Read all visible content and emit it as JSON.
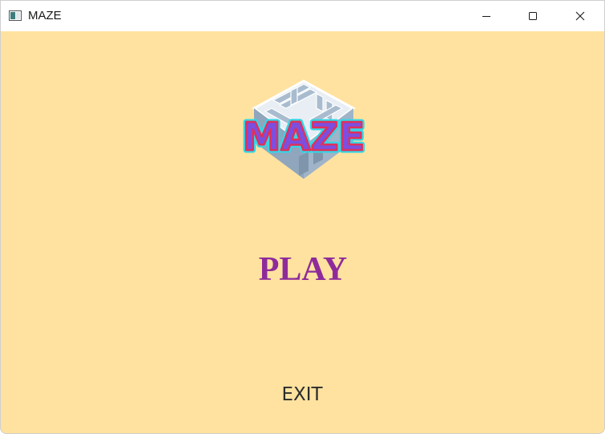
{
  "window": {
    "title": "MAZE",
    "app_icon": "window-app-icon",
    "controls": {
      "minimize_icon": "minimize-icon",
      "maximize_icon": "maximize-icon",
      "close_icon": "close-icon"
    }
  },
  "menu": {
    "logo_text": "MAZE",
    "play_label": "PLAY",
    "exit_label": "EXIT"
  },
  "colors": {
    "background": "#ffe29f",
    "titlebar": "#ffffff",
    "play_text": "#8e2b9b",
    "exit_text": "#2b2b2b",
    "logo_fill": "#7b4fe0",
    "logo_outline": "#e0305a",
    "logo_glow": "#33d6e6",
    "maze_wall": "#a9bccf"
  }
}
